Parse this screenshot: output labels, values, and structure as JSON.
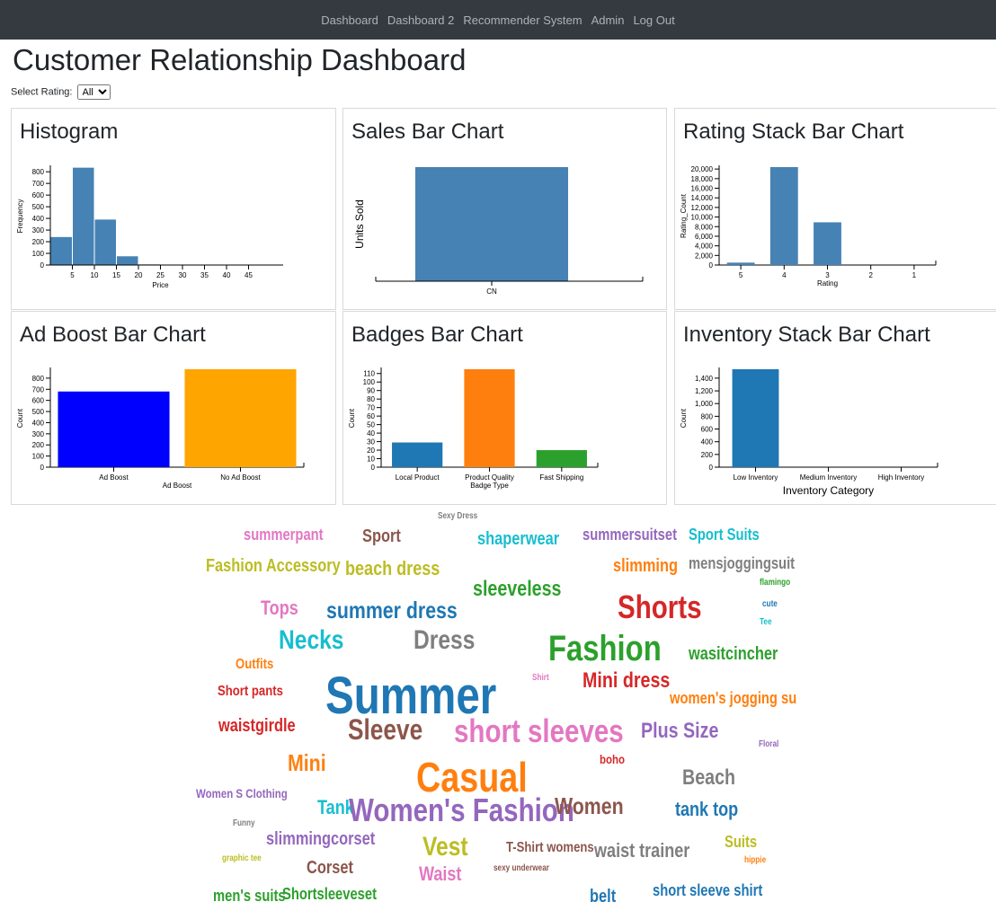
{
  "nav": [
    "Dashboard",
    "Dashboard 2",
    "Recommender System",
    "Admin",
    "Log Out"
  ],
  "page_title": "Customer Relationship Dashboard",
  "filter": {
    "label": "Select Rating:",
    "selected": "All"
  },
  "panels": {
    "histogram": {
      "title": "Histogram"
    },
    "sales": {
      "title": "Sales Bar Chart"
    },
    "rating": {
      "title": "Rating Stack Bar Chart"
    },
    "adboost": {
      "title": "Ad Boost Bar Chart"
    },
    "badges": {
      "title": "Badges Bar Chart"
    },
    "inventory": {
      "title": "Inventory Stack Bar Chart"
    }
  },
  "chart_data": [
    {
      "id": "histogram",
      "type": "bar",
      "xlabel": "Price",
      "ylabel": "Frequency",
      "bins": [
        [
          0,
          5,
          240
        ],
        [
          5,
          10,
          835
        ],
        [
          10,
          15,
          390
        ],
        [
          15,
          20,
          75
        ],
        [
          20,
          25,
          5
        ],
        [
          25,
          30,
          0
        ],
        [
          30,
          35,
          0
        ],
        [
          35,
          40,
          0
        ],
        [
          40,
          45,
          0
        ],
        [
          45,
          50,
          0
        ]
      ],
      "xticks": [
        5,
        10,
        15,
        20,
        25,
        30,
        35,
        40,
        45
      ],
      "yticks": [
        0,
        100,
        200,
        300,
        400,
        500,
        600,
        700,
        800
      ],
      "ylim": [
        0,
        840
      ],
      "xlim": [
        0,
        50
      ],
      "color": "#4682b4"
    },
    {
      "id": "sales",
      "type": "bar",
      "xlabel": "",
      "ylabel": "Units Sold",
      "categories": [
        "CN"
      ],
      "values": [
        1
      ],
      "color": "#4682b4"
    },
    {
      "id": "rating",
      "type": "bar",
      "xlabel": "Rating",
      "ylabel": "Rating_Count",
      "categories": [
        "5",
        "4",
        "3",
        "2",
        "1"
      ],
      "values": [
        500,
        20400,
        8900,
        0,
        0
      ],
      "yticks": [
        0,
        2000,
        4000,
        6000,
        8000,
        10000,
        12000,
        14000,
        16000,
        18000,
        20000
      ],
      "ylim": [
        0,
        20400
      ],
      "color": "#4682b4"
    },
    {
      "id": "adboost",
      "type": "bar",
      "xlabel": "Ad Boost",
      "ylabel": "Count",
      "categories": [
        "Ad Boost",
        "No Ad Boost"
      ],
      "values": [
        680,
        880
      ],
      "yticks": [
        0,
        100,
        200,
        300,
        400,
        500,
        600,
        700,
        800
      ],
      "ylim": [
        0,
        880
      ],
      "colors": [
        "#0000ff",
        "#ffa500"
      ]
    },
    {
      "id": "badges",
      "type": "bar",
      "xlabel": "Badge Type",
      "ylabel": "Count",
      "categories": [
        "Local Product",
        "Product Quality",
        "Fast Shipping"
      ],
      "values": [
        29,
        115,
        20
      ],
      "yticks": [
        0,
        10,
        20,
        30,
        40,
        50,
        60,
        70,
        80,
        90,
        100,
        110
      ],
      "ylim": [
        0,
        115
      ],
      "colors": [
        "#1f77b4",
        "#ff7f0e",
        "#2ca02c"
      ]
    },
    {
      "id": "inventory",
      "type": "bar",
      "xlabel": "Inventory Category",
      "ylabel": "Count",
      "categories": [
        "Low Inventory",
        "Medium Inventory",
        "High Inventory"
      ],
      "values": [
        1540,
        0,
        0
      ],
      "yticks": [
        0,
        200,
        400,
        600,
        800,
        1000,
        1200,
        1400
      ],
      "ylim": [
        0,
        1540
      ],
      "color": "#1f77b4"
    }
  ],
  "wordcloud": [
    {
      "text": "Sexy Dress",
      "color": "#7f7f7f"
    },
    {
      "text": "summerpant",
      "color": "#e377c2"
    },
    {
      "text": "Sport",
      "color": "#8c564b"
    },
    {
      "text": "shaperwear",
      "color": "#17becf"
    },
    {
      "text": "summersuitset",
      "color": "#9467bd"
    },
    {
      "text": "Sport Suits",
      "color": "#17becf"
    },
    {
      "text": "Fashion Accessory",
      "color": "#bcbd22"
    },
    {
      "text": "beach dress",
      "color": "#bcbd22"
    },
    {
      "text": "slimming",
      "color": "#ff7f0e"
    },
    {
      "text": "mensjoggingsuit",
      "color": "#7f7f7f"
    },
    {
      "text": "sleeveless",
      "color": "#2ca02c"
    },
    {
      "text": "flamingo",
      "color": "#2ca02c"
    },
    {
      "text": "Tops",
      "color": "#e377c2"
    },
    {
      "text": "summer dress",
      "color": "#1f77b4"
    },
    {
      "text": "Shorts",
      "color": "#d62728"
    },
    {
      "text": "cute",
      "color": "#1f77b4"
    },
    {
      "text": "Tee",
      "color": "#17becf"
    },
    {
      "text": "Necks",
      "color": "#17becf"
    },
    {
      "text": "Dress",
      "color": "#7f7f7f"
    },
    {
      "text": "Fashion",
      "color": "#2ca02c"
    },
    {
      "text": "wasitcincher",
      "color": "#2ca02c"
    },
    {
      "text": "Outfits",
      "color": "#ff7f0e"
    },
    {
      "text": "Shirt",
      "color": "#e377c2"
    },
    {
      "text": "Mini dress",
      "color": "#d62728"
    },
    {
      "text": "Short pants",
      "color": "#d62728"
    },
    {
      "text": "Summer",
      "color": "#1f77b4"
    },
    {
      "text": "women's jogging su",
      "color": "#ff7f0e"
    },
    {
      "text": "waistgirdle",
      "color": "#d62728"
    },
    {
      "text": "Sleeve",
      "color": "#8c564b"
    },
    {
      "text": "short sleeves",
      "color": "#e377c2"
    },
    {
      "text": "Plus Size",
      "color": "#9467bd"
    },
    {
      "text": "Floral",
      "color": "#9467bd"
    },
    {
      "text": "Mini",
      "color": "#ff7f0e"
    },
    {
      "text": "boho",
      "color": "#d62728"
    },
    {
      "text": "Casual",
      "color": "#ff7f0e"
    },
    {
      "text": "Beach",
      "color": "#7f7f7f"
    },
    {
      "text": "Women S Clothing",
      "color": "#9467bd"
    },
    {
      "text": "Tank",
      "color": "#17becf"
    },
    {
      "text": "Women's Fashion",
      "color": "#9467bd"
    },
    {
      "text": "Women",
      "color": "#8c564b"
    },
    {
      "text": "tank top",
      "color": "#1f77b4"
    },
    {
      "text": "Funny",
      "color": "#7f7f7f"
    },
    {
      "text": "slimmingcorset",
      "color": "#9467bd"
    },
    {
      "text": "Vest",
      "color": "#bcbd22"
    },
    {
      "text": "T-Shirt womens",
      "color": "#8c564b"
    },
    {
      "text": "waist trainer",
      "color": "#7f7f7f"
    },
    {
      "text": "Suits",
      "color": "#bcbd22"
    },
    {
      "text": "graphic tee",
      "color": "#bcbd22"
    },
    {
      "text": "hippie",
      "color": "#ff7f0e"
    },
    {
      "text": "Corset",
      "color": "#8c564b"
    },
    {
      "text": "Waist",
      "color": "#e377c2"
    },
    {
      "text": "sexy underwear",
      "color": "#8c564b"
    },
    {
      "text": "men's suits",
      "color": "#2ca02c"
    },
    {
      "text": "Shortsleeveset",
      "color": "#2ca02c"
    },
    {
      "text": "belt",
      "color": "#1f77b4"
    },
    {
      "text": "short sleeve shirt",
      "color": "#1f77b4"
    }
  ]
}
